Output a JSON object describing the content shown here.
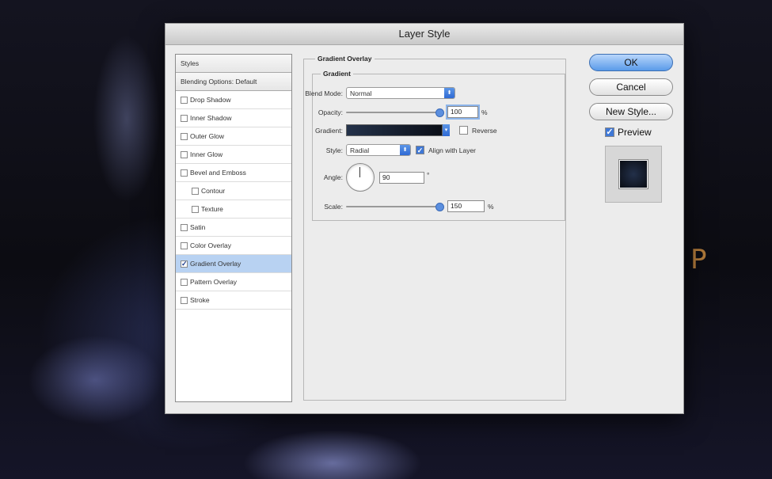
{
  "dialog": {
    "title": "Layer Style"
  },
  "styles_list": {
    "header": "Styles",
    "blending": "Blending Options: Default",
    "items": [
      {
        "label": "Drop Shadow",
        "checked": false,
        "indent": false
      },
      {
        "label": "Inner Shadow",
        "checked": false,
        "indent": false
      },
      {
        "label": "Outer Glow",
        "checked": false,
        "indent": false
      },
      {
        "label": "Inner Glow",
        "checked": false,
        "indent": false
      },
      {
        "label": "Bevel and Emboss",
        "checked": false,
        "indent": false
      },
      {
        "label": "Contour",
        "checked": false,
        "indent": true
      },
      {
        "label": "Texture",
        "checked": false,
        "indent": true
      },
      {
        "label": "Satin",
        "checked": false,
        "indent": false
      },
      {
        "label": "Color Overlay",
        "checked": false,
        "indent": false
      },
      {
        "label": "Gradient Overlay",
        "checked": true,
        "indent": false,
        "selected": true
      },
      {
        "label": "Pattern Overlay",
        "checked": false,
        "indent": false
      },
      {
        "label": "Stroke",
        "checked": false,
        "indent": false
      }
    ]
  },
  "panel": {
    "section_title": "Gradient Overlay",
    "group_title": "Gradient",
    "blend_mode": {
      "label": "Blend Mode:",
      "value": "Normal"
    },
    "opacity": {
      "label": "Opacity:",
      "value": "100",
      "unit": "%",
      "level": 1.0
    },
    "gradient": {
      "label": "Gradient:",
      "reverse_label": "Reverse",
      "reverse_checked": false
    },
    "style": {
      "label": "Style:",
      "value": "Radial",
      "align_label": "Align with Layer",
      "align_checked": true
    },
    "angle": {
      "label": "Angle:",
      "value": "90",
      "unit": "°"
    },
    "scale": {
      "label": "Scale:",
      "value": "150",
      "unit": "%",
      "level": 1.0
    }
  },
  "buttons": {
    "ok": "OK",
    "cancel": "Cancel",
    "new_style": "New Style..."
  },
  "preview": {
    "label": "Preview",
    "checked": true
  },
  "background_text": "P"
}
